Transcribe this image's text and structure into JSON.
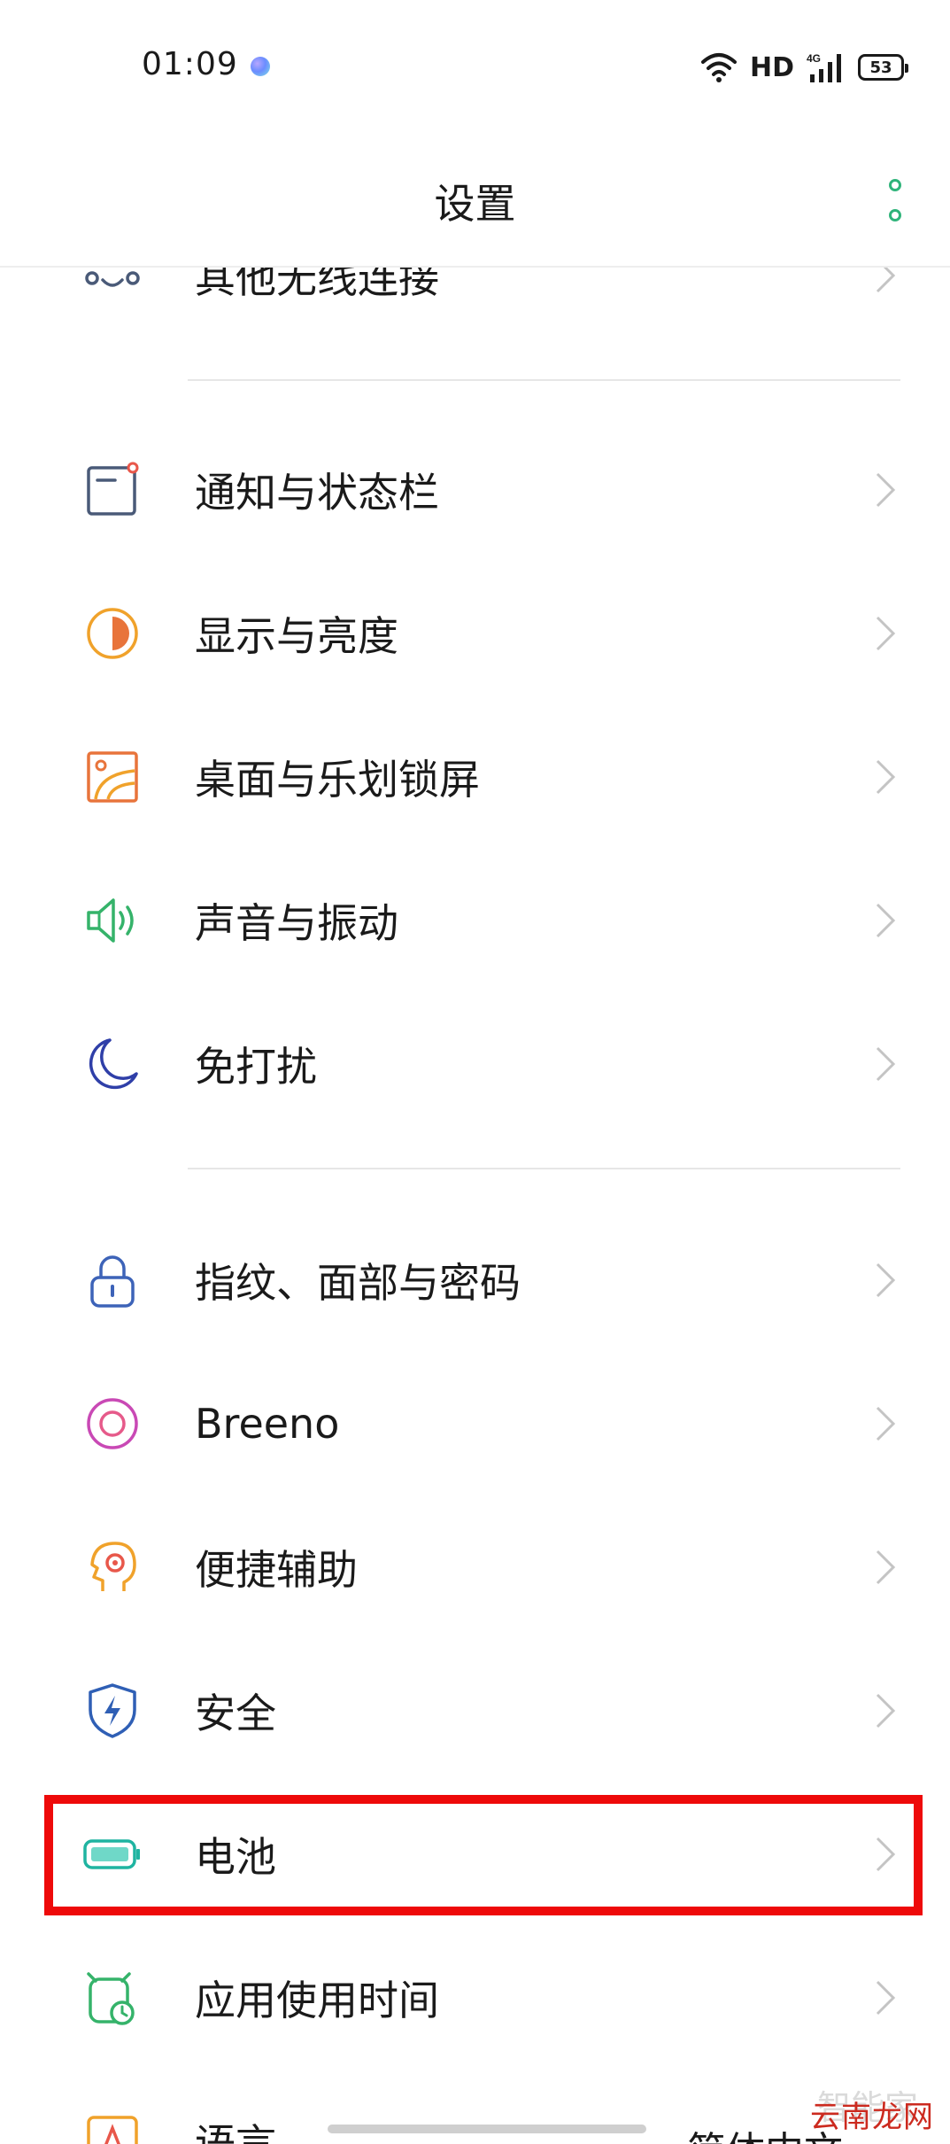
{
  "status_bar": {
    "time": "01:09",
    "network": "HD",
    "signal_type": "4G",
    "battery": "53"
  },
  "header": {
    "title": "设置"
  },
  "items": [
    {
      "label": "其他无线连接",
      "icon": "other-wireless-icon",
      "color": "#4a5a78"
    },
    {
      "label": "通知与状态栏",
      "icon": "notification-icon",
      "color": "#4a5a78"
    },
    {
      "label": "显示与亮度",
      "icon": "display-brightness-icon",
      "color": "#f0a22b"
    },
    {
      "label": "桌面与乐划锁屏",
      "icon": "wallpaper-icon",
      "color": "#e8743b"
    },
    {
      "label": "声音与振动",
      "icon": "speaker-icon",
      "color": "#35b36a"
    },
    {
      "label": "免打扰",
      "icon": "moon-icon",
      "color": "#2f3fa8"
    },
    {
      "label": "指纹、面部与密码",
      "icon": "lock-icon",
      "color": "#3d63b8"
    },
    {
      "label": "Breeno",
      "icon": "breeno-icon",
      "color": "#c949b5"
    },
    {
      "label": "便捷辅助",
      "icon": "assist-head-icon",
      "color": "#f0a22b"
    },
    {
      "label": "安全",
      "icon": "shield-icon",
      "color": "#2f5fb5"
    },
    {
      "label": "电池",
      "icon": "battery-icon",
      "color": "#1fb4a1"
    },
    {
      "label": "应用使用时间",
      "icon": "clock-icon",
      "color": "#35b36a"
    },
    {
      "label": "语言",
      "icon": "language-icon",
      "color": "#f0a22b"
    }
  ],
  "partial_bottom_right": "简体中文",
  "watermark": {
    "main": "云南龙网",
    "faint": "智能家"
  },
  "accent_color": "#2fb47a",
  "highlight_color": "#ee0a0a"
}
